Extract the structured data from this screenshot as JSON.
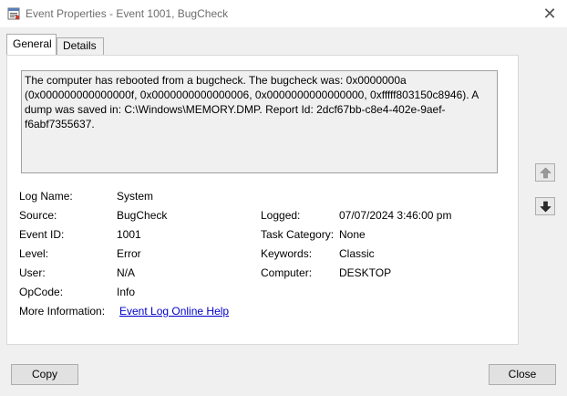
{
  "window": {
    "title": "Event Properties - Event 1001, BugCheck",
    "close_glyph": "✕"
  },
  "tabs": [
    {
      "label": "General",
      "active": true
    },
    {
      "label": "Details",
      "active": false
    }
  ],
  "general": {
    "description": "The computer has rebooted from a bugcheck.  The bugcheck was: 0x0000000a (0x000000000000000f, 0x0000000000000006, 0x0000000000000000, 0xfffff803150c8946). A dump was saved in: C:\\Windows\\MEMORY.DMP. Report Id: 2dcf67bb-c8e4-402e-9aef-f6abf7355637.",
    "log_name_label": "Log Name:",
    "log_name_value": "System",
    "source_label": "Source:",
    "source_value": "BugCheck",
    "logged_label": "Logged:",
    "logged_value": "07/07/2024 3:46:00 pm",
    "event_id_label": "Event ID:",
    "event_id_value": "1001",
    "task_category_label": "Task Category:",
    "task_category_value": "None",
    "level_label": "Level:",
    "level_value": "Error",
    "keywords_label": "Keywords:",
    "keywords_value": "Classic",
    "user_label": "User:",
    "user_value": "N/A",
    "computer_label": "Computer:",
    "computer_value": "DESKTOP",
    "opcode_label": "OpCode:",
    "opcode_value": "Info",
    "more_info_label": "More Information:",
    "more_info_link": "Event Log Online Help"
  },
  "buttons": {
    "copy": "Copy",
    "close": "Close"
  },
  "icons": {
    "title": "event-viewer-icon",
    "up": "arrow-up-icon",
    "down": "arrow-down-icon"
  },
  "colors": {
    "link": "#0000cc",
    "window_bg": "#f0f0f0",
    "panel_bg": "#ffffff"
  }
}
